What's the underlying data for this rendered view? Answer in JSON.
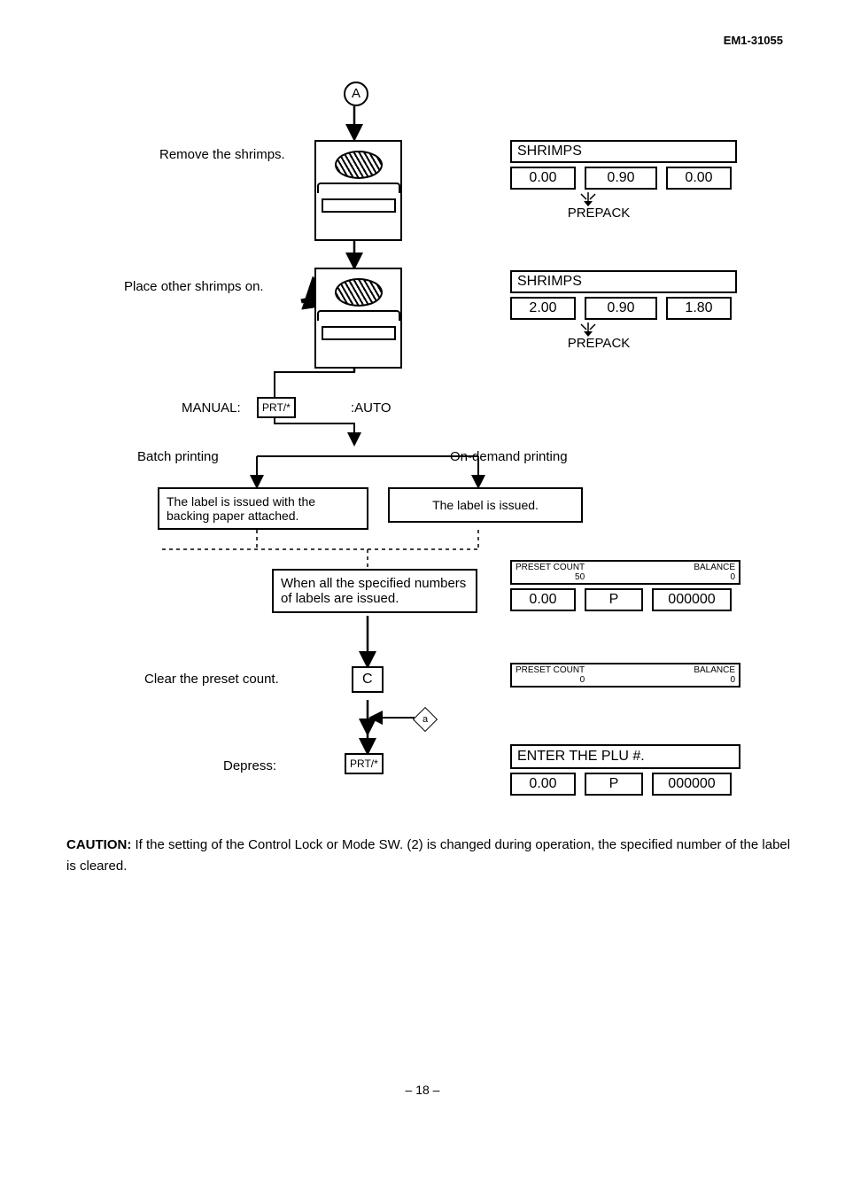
{
  "docId": "EM1-31055",
  "pageNumber": "– 18 –",
  "nodeA": "A",
  "step1Label": "Remove the shrimps.",
  "step2Label": "Place other shrimps on.",
  "modeManual": "MANUAL:",
  "modeAuto": ":AUTO",
  "keyPrt": "PRT/*",
  "keyPrt2": "PRT/*",
  "keyC": "C",
  "branchBatch": "Batch printing",
  "branchOnDemand": "On-demand printing",
  "boxBatch": "The label is issued with the backing paper attached.",
  "boxOnDemand": "The label is issued.",
  "boxSpecified": "When all the specified numbers of labels are issued.",
  "stepClear": "Clear the preset count.",
  "stepDepress": "Depress:",
  "joinA": "a",
  "lcd1": {
    "title": "SHRIMPS",
    "v1": "0.00",
    "v2": "0.90",
    "v3": "0.00",
    "mode": "PREPACK"
  },
  "lcd2": {
    "title": "SHRIMPS",
    "v1": "2.00",
    "v2": "0.90",
    "v3": "1.80",
    "mode": "PREPACK"
  },
  "lcd3": {
    "preLabel": "PRESET COUNT",
    "preVal": "50",
    "balLabel": "BALANCE",
    "balVal": "0",
    "v1": "0.00",
    "v2": "P",
    "v3": "000000"
  },
  "lcd4": {
    "preLabel": "PRESET COUNT",
    "preVal": "0",
    "balLabel": "BALANCE",
    "balVal": "0"
  },
  "lcd5": {
    "title": "ENTER THE PLU #.",
    "v1": "0.00",
    "v2": "P",
    "v3": "000000"
  },
  "caution": {
    "label": "CAUTION:",
    "text": "If the setting of the Control Lock or Mode SW. (2) is changed during operation, the specified number of the label is cleared."
  }
}
